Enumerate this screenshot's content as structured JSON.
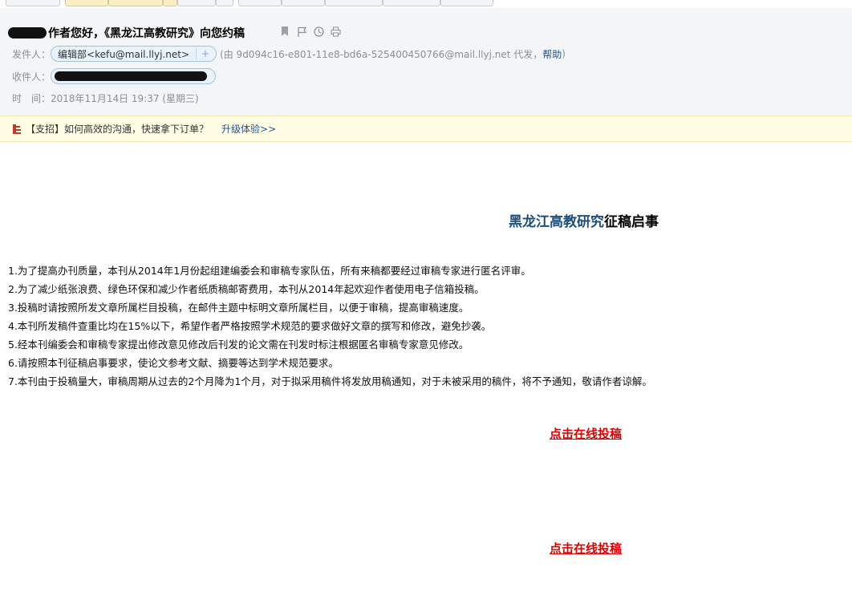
{
  "mail": {
    "subject": "作者您好，《黑龙江高教研究》向您约稿",
    "from_label": "发件人：",
    "from_name": "编辑部<kefu@mail.llyj.net>",
    "add_contact": "+",
    "via_prefix": "(由 9d094c16-e801-11e8-bd6a-525400450766@mail.llyj.net 代发，",
    "help_link": "帮助",
    "via_suffix": ")",
    "to_label": "收件人：",
    "time_label": "时　间：",
    "time_value": "2018年11月14日 19:37 (星期三)"
  },
  "notice": {
    "text": "【支招】如何高效的沟通，快速拿下订单？",
    "link": "升级体验>>"
  },
  "content": {
    "title_blue": "黑龙江高教研究",
    "title_black": "征稿启事",
    "items": [
      "1.为了提高办刊质量，本刊从2014年1月份起组建编委会和审稿专家队伍，所有来稿都要经过审稿专家进行匿名评审。",
      "2.为了减少纸张浪费、绿色环保和减少作者纸质稿邮寄费用，本刊从2014年起欢迎作者使用电子信箱投稿。",
      "3.投稿时请按照所发文章所属栏目投稿，在邮件主题中标明文章所属栏目，以便于审稿，提高审稿速度。",
      "4.本刊所发稿件查重比均在15%以下，希望作者严格按照学术规范的要求做好文章的撰写和修改，避免抄袭。",
      "5.经本刊编委会和审稿专家提出修改意见修改后刊发的论文需在刊发时标注根据匿名审稿专家意见修改。",
      "6.请按照本刊征稿启事要求，使论文参考文献、摘要等达到学术规范要求。",
      "7.本刊由于投稿量大，审稿周期从过去的2个月降为1个月，对于拟采用稿件将发放用稿通知，对于未被采用的稿件，将不予通知，敬请作者谅解。"
    ],
    "cta_1": "点击在线投稿",
    "cta_2": "点击在线投稿"
  },
  "icons": [
    "bookmark-icon",
    "flag-icon",
    "clock-icon",
    "print-icon",
    "notice-icon"
  ],
  "colors": {
    "title_blue": "#1f4e79",
    "cta_red": "#e00000",
    "link_blue": "#1e5494"
  }
}
